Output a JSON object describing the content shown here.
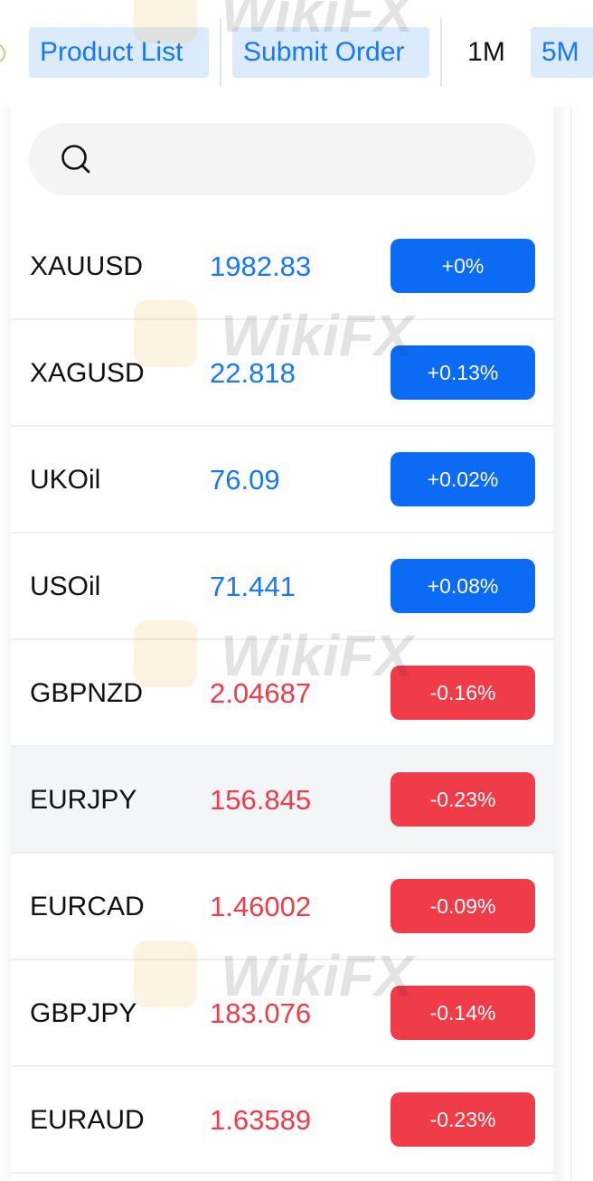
{
  "header": {
    "tabs": [
      {
        "label": "Product List"
      },
      {
        "label": "Submit Order"
      }
    ],
    "timeframes": [
      {
        "label": "1M",
        "active": false
      },
      {
        "label": "5M",
        "active": true
      }
    ]
  },
  "search": {
    "placeholder": "",
    "icon": "search-icon"
  },
  "products": [
    {
      "symbol": "XAUUSD",
      "price": "1982.83",
      "change": "+0%",
      "direction": "up"
    },
    {
      "symbol": "XAGUSD",
      "price": "22.818",
      "change": "+0.13%",
      "direction": "up"
    },
    {
      "symbol": "UKOil",
      "price": "76.09",
      "change": "+0.02%",
      "direction": "up"
    },
    {
      "symbol": "USOil",
      "price": "71.441",
      "change": "+0.08%",
      "direction": "up"
    },
    {
      "symbol": "GBPNZD",
      "price": "2.04687",
      "change": "-0.16%",
      "direction": "down"
    },
    {
      "symbol": "EURJPY",
      "price": "156.845",
      "change": "-0.23%",
      "direction": "down"
    },
    {
      "symbol": "EURCAD",
      "price": "1.46002",
      "change": "-0.09%",
      "direction": "down"
    },
    {
      "symbol": "GBPJPY",
      "price": "183.076",
      "change": "-0.14%",
      "direction": "down"
    },
    {
      "symbol": "EURAUD",
      "price": "1.63589",
      "change": "-0.23%",
      "direction": "down"
    }
  ],
  "highlighted_row": 5,
  "watermark": {
    "text": "WikiFX"
  },
  "colors": {
    "accent": "#1677ff",
    "up": "#0c6bf5",
    "down": "#f03b49",
    "tab_bg": "#dcebfb"
  }
}
